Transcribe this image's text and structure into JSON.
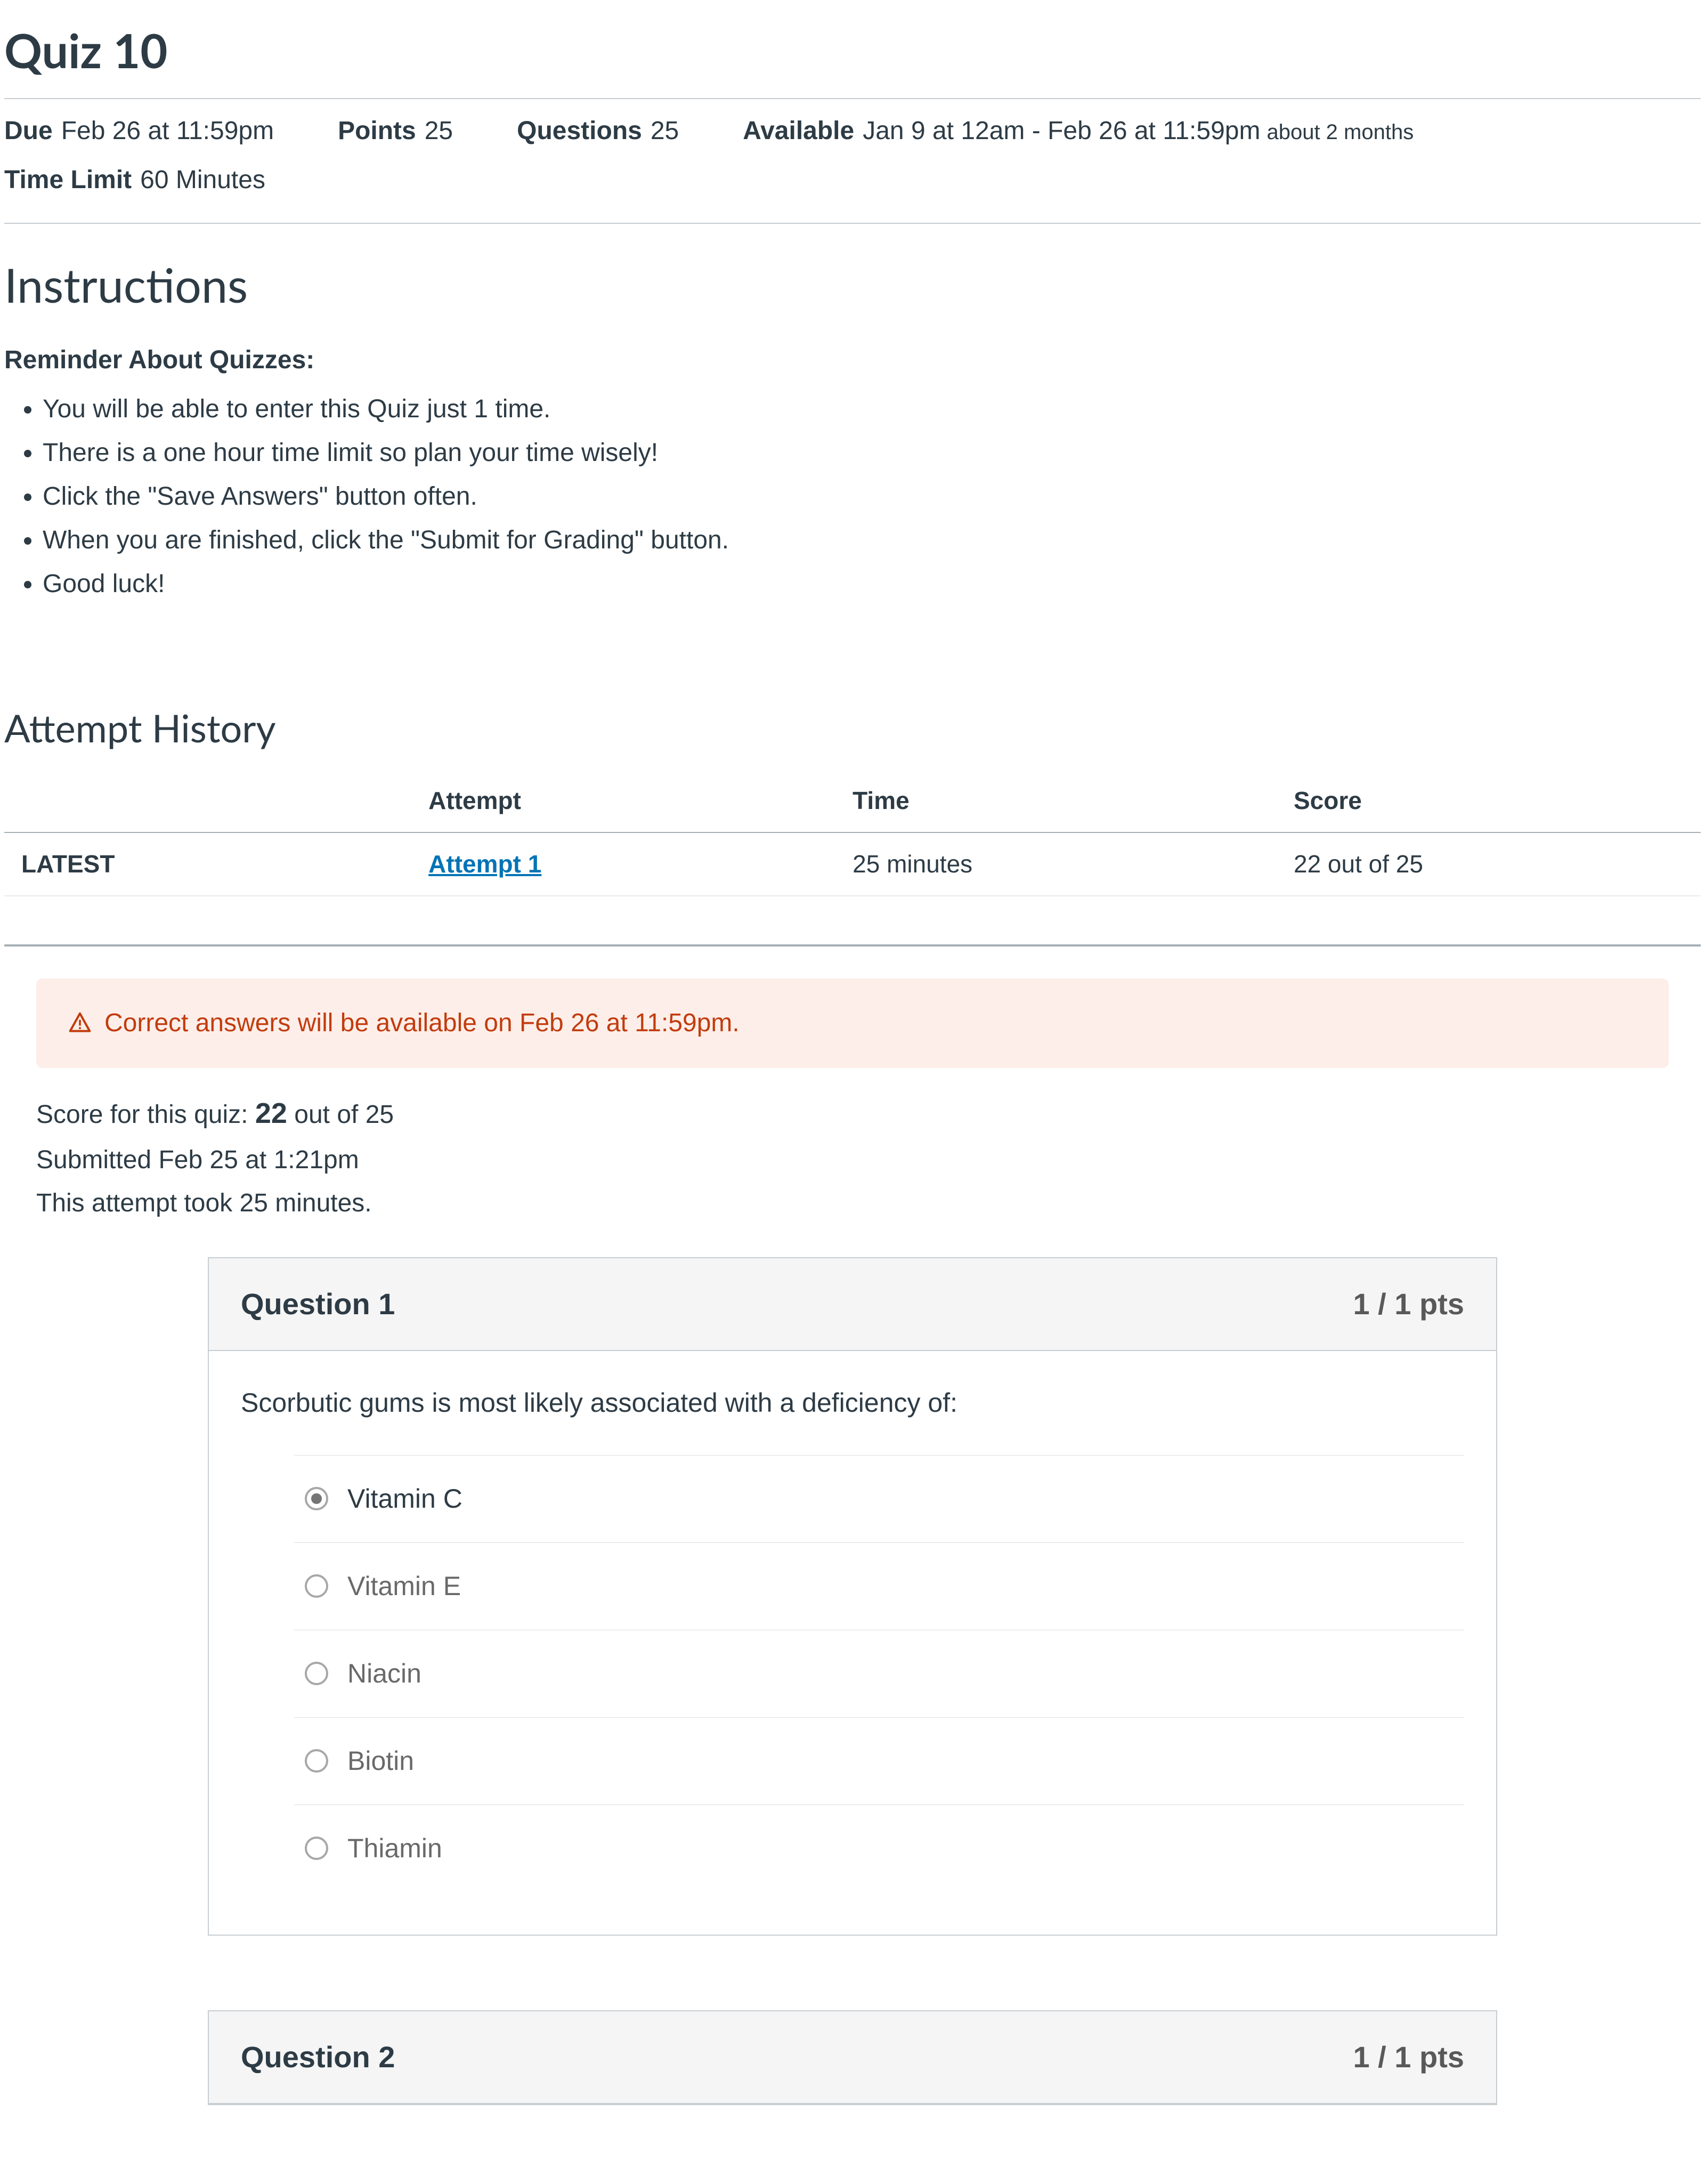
{
  "page_title": "Quiz 10",
  "meta": {
    "due_label": "Due",
    "due_value": "Feb 26 at 11:59pm",
    "points_label": "Points",
    "points_value": "25",
    "questions_label": "Questions",
    "questions_value": "25",
    "available_label": "Available",
    "available_value": "Jan 9 at 12am - Feb 26 at 11:59pm",
    "available_sub": "about 2 months",
    "timelimit_label": "Time Limit",
    "timelimit_value": "60 Minutes"
  },
  "instructions": {
    "heading": "Instructions",
    "reminder_label": "Reminder About Quizzes:",
    "items": [
      "You will be able to enter this Quiz just 1 time.",
      "There is a one hour time limit so plan your time wisely!",
      "Click the \"Save Answers\" button often.",
      "When you are finished, click the \"Submit for Grading\" button.",
      "Good luck!"
    ]
  },
  "attempt_history": {
    "heading": "Attempt History",
    "cols": {
      "c0": "",
      "c1": "Attempt",
      "c2": "Time",
      "c3": "Score"
    },
    "row": {
      "latest": "LATEST",
      "attempt_link": "Attempt 1",
      "time": "25 minutes",
      "score": "22 out of 25"
    }
  },
  "alert_text": "Correct answers will be available on Feb 26 at 11:59pm.",
  "score_block": {
    "line1_prefix": "Score for this quiz: ",
    "line1_score": "22",
    "line1_suffix": " out of 25",
    "line2": "Submitted Feb 25 at 1:21pm",
    "line3": "This attempt took 25 minutes."
  },
  "q1": {
    "title": "Question 1",
    "pts": "1 / 1 pts",
    "text": "Scorbutic gums is most likely associated with a deficiency of:",
    "answers": [
      "Vitamin C",
      "Vitamin E",
      "Niacin",
      "Biotin",
      "Thiamin"
    ],
    "selected_index": 0
  },
  "q2": {
    "title": "Question 2",
    "pts": "1 / 1 pts"
  }
}
